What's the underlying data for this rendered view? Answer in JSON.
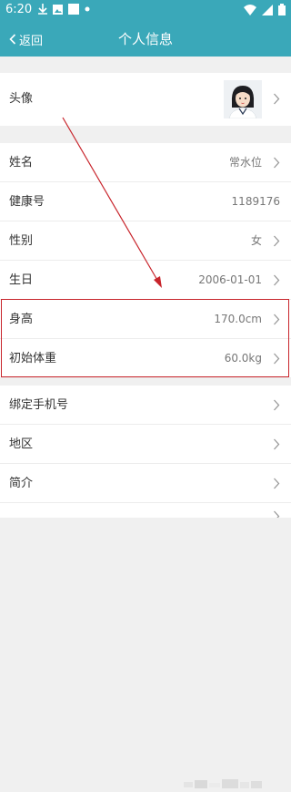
{
  "status_bar": {
    "time": "6:20",
    "left_icons": [
      "download-icon",
      "photo-icon",
      "square-icon",
      "dot-icon"
    ],
    "right_icons": [
      "wifi-icon",
      "signal-icon",
      "battery-icon"
    ]
  },
  "nav": {
    "back_label": "返回",
    "title": "个人信息"
  },
  "avatar_row": {
    "label": "头像"
  },
  "rows": [
    {
      "label": "姓名",
      "value": "常水位"
    },
    {
      "label": "健康号",
      "value": "1189176"
    },
    {
      "label": "性别",
      "value": "女"
    },
    {
      "label": "生日",
      "value": "2006-01-01"
    },
    {
      "label": "身高",
      "value": "170.0cm"
    },
    {
      "label": "初始体重",
      "value": "60.0kg"
    },
    {
      "label": "绑定手机号",
      "value": ""
    },
    {
      "label": "地区",
      "value": ""
    },
    {
      "label": "简介",
      "value": ""
    },
    {
      "label": "",
      "value": ""
    }
  ],
  "colors": {
    "header": "#3aa8b9",
    "highlight": "#c8242b",
    "annotation_arrow": "#c8242b"
  }
}
